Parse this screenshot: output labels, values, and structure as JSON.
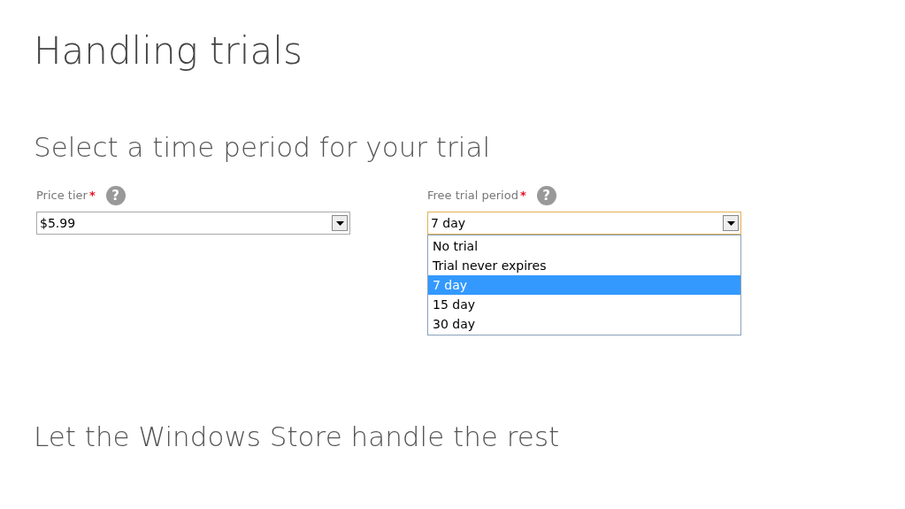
{
  "title": "Handling trials",
  "subtitle": "Select a time period for your trial",
  "fields": [
    {
      "label": "Price tier",
      "required_mark": "*",
      "help": "?",
      "value": "$5.99",
      "focused": false
    },
    {
      "label": "Free trial period",
      "required_mark": "*",
      "help": "?",
      "value": "7 day",
      "focused": true,
      "options": [
        {
          "label": "No trial",
          "selected": false
        },
        {
          "label": "Trial never expires",
          "selected": false
        },
        {
          "label": "7 day",
          "selected": true
        },
        {
          "label": "15 day",
          "selected": false
        },
        {
          "label": "30 day",
          "selected": false
        }
      ]
    }
  ],
  "footer": "Let the Windows Store handle the rest"
}
